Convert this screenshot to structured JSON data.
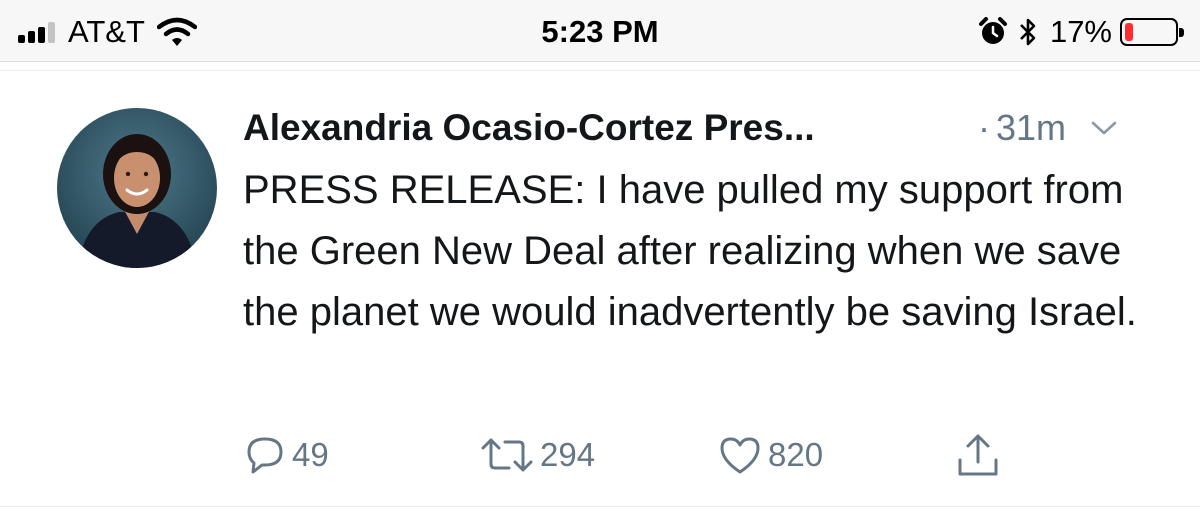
{
  "status_bar": {
    "carrier": "AT&T",
    "time": "5:23 PM",
    "battery_percent": "17%",
    "battery_level": 0.17,
    "battery_color": "#ff2d2d",
    "signal_bars_filled": 3,
    "icons": [
      "signal-icon",
      "wifi-icon",
      "alarm-icon",
      "bluetooth-icon",
      "battery-icon"
    ]
  },
  "tweet": {
    "author_name": "Alexandria Ocasio-Cortez Pres...",
    "separator": "·",
    "timestamp": "31m",
    "text": "PRESS RELEASE: I have pulled my support from the Green New Deal after realizing when we save the planet we would inadvertently be saving Israel.",
    "actions": {
      "reply_count": "49",
      "retweet_count": "294",
      "like_count": "820"
    },
    "icons": [
      "avatar",
      "chevron-down-icon",
      "reply-icon",
      "retweet-icon",
      "like-icon",
      "share-icon"
    ]
  },
  "colors": {
    "text_primary": "#14171a",
    "text_secondary": "#657786",
    "status_bar_bg": "#f7f7f7",
    "divider": "#e6ecf0"
  }
}
